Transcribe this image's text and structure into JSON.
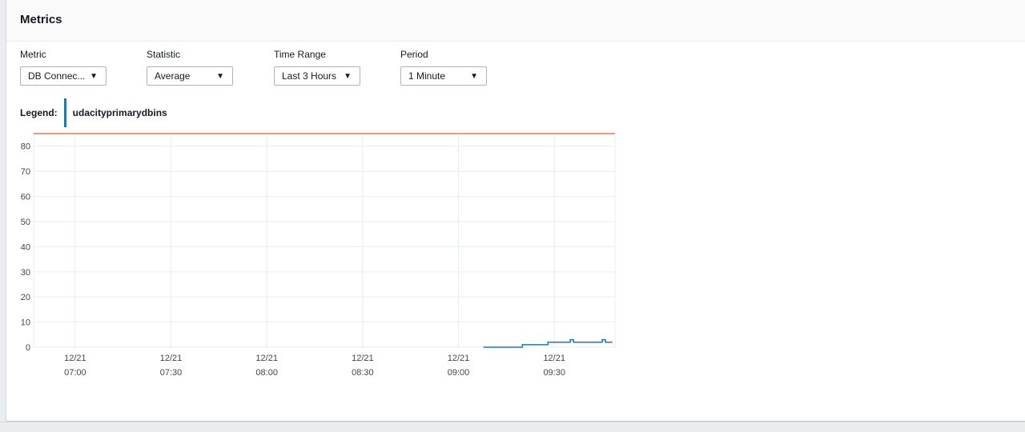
{
  "panel": {
    "title": "Metrics"
  },
  "controls": {
    "metric": {
      "label": "Metric",
      "value": "DB Connec..."
    },
    "statistic": {
      "label": "Statistic",
      "value": "Average"
    },
    "timeRange": {
      "label": "Time Range",
      "value": "Last 3 Hours"
    },
    "period": {
      "label": "Period",
      "value": "1 Minute"
    }
  },
  "legend": {
    "label": "Legend:",
    "series_name": "udacityprimarydbins"
  },
  "icons": {
    "dropdown": "caret-down-icon"
  },
  "colors": {
    "series": "#1f77b4",
    "threshold": "#d13212",
    "grid": "#eaeded"
  },
  "chart_data": {
    "type": "line",
    "title": "",
    "xlabel": "",
    "ylabel": "",
    "ylim": [
      0,
      85
    ],
    "xlim": [
      "12/21 06:47",
      "12/21 09:49"
    ],
    "yticks": [
      0,
      10,
      20,
      30,
      40,
      50,
      60,
      70,
      80
    ],
    "xticks": [
      {
        "date": "12/21",
        "time": "07:00"
      },
      {
        "date": "12/21",
        "time": "07:30"
      },
      {
        "date": "12/21",
        "time": "08:00"
      },
      {
        "date": "12/21",
        "time": "08:30"
      },
      {
        "date": "12/21",
        "time": "09:00"
      },
      {
        "date": "12/21",
        "time": "09:30"
      }
    ],
    "grid": true,
    "threshold": 85,
    "series": [
      {
        "name": "udacityprimarydbins",
        "step": true,
        "points": [
          {
            "x": "12/21 09:08",
            "y": 0
          },
          {
            "x": "12/21 09:20",
            "y": 1
          },
          {
            "x": "12/21 09:28",
            "y": 2
          },
          {
            "x": "12/21 09:35",
            "y": 3
          },
          {
            "x": "12/21 09:36",
            "y": 2
          },
          {
            "x": "12/21 09:42",
            "y": 2
          },
          {
            "x": "12/21 09:45",
            "y": 3
          },
          {
            "x": "12/21 09:46",
            "y": 2
          },
          {
            "x": "12/21 09:48",
            "y": 2
          }
        ]
      }
    ]
  }
}
